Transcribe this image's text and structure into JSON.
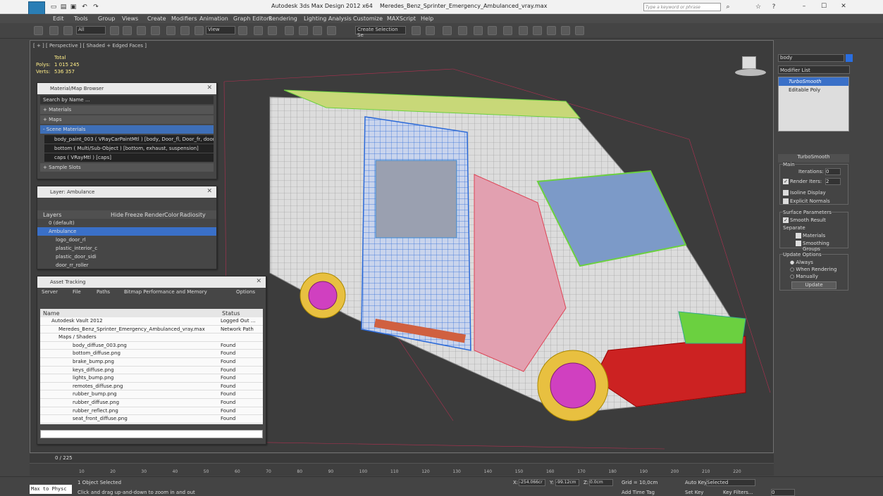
{
  "title": {
    "app": "Autodesk 3ds Max Design 2012 x64",
    "file": "Meredes_Benz_Sprinter_Emergency_Ambulanced_vray.max",
    "search_placeholder": "Type a keyword or phrase"
  },
  "menu": [
    "Edit",
    "Tools",
    "Group",
    "Views",
    "Create",
    "Modifiers",
    "Animation",
    "Graph Editors",
    "Rendering",
    "Lighting Analysis",
    "Customize",
    "MAXScript",
    "Help"
  ],
  "toolbar": {
    "filter": "All",
    "refcoord": "View",
    "selset": "Create Selection Se"
  },
  "viewport": {
    "label": "[ + ] [ Perspective ] [ Shaded + Edged Faces ]",
    "stats_total": "Total",
    "polys_label": "Polys:",
    "polys": "1 015 245",
    "verts_label": "Verts:",
    "verts": "536 357"
  },
  "material_browser": {
    "title": "Material/Map Browser",
    "search": "Search by Name ...",
    "groups": [
      "+ Materials",
      "+ Maps",
      "- Scene Materials"
    ],
    "items": [
      "body_paint_003 ( VRayCarPaintMtl ) [body, Door_fl, Door_fr, door_...",
      "bottom ( Multi/Sub-Object ) [bottom, exhaust, suspension]",
      "caps ( VRayMtl ) [caps]"
    ],
    "sample": "+ Sample Slots"
  },
  "layer": {
    "title": "Layer: Ambulance",
    "cols": [
      "Layers",
      "Hide",
      "Freeze",
      "Render",
      "Color",
      "Radiosity"
    ],
    "rows": [
      "0 (default)",
      "Ambulance",
      "logo_door_rl",
      "plastic_interior_c",
      "plastic_door_sidi",
      "door_rr_roller"
    ]
  },
  "asset": {
    "title": "Asset Tracking",
    "menu": [
      "Server",
      "File",
      "Paths",
      "Bitmap Performance and Memory",
      "Options"
    ],
    "cols": [
      "Name",
      "Status"
    ],
    "rows": [
      {
        "name": "Autodesk Vault 2012",
        "status": "Logged Out ..."
      },
      {
        "name": "Meredes_Benz_Sprinter_Emergency_Ambulanced_vray.max",
        "status": "Network Path"
      },
      {
        "name": "Maps / Shaders",
        "status": ""
      },
      {
        "name": "body_diffuse_003.png",
        "status": "Found"
      },
      {
        "name": "bottom_diffuse.png",
        "status": "Found"
      },
      {
        "name": "brake_bump.png",
        "status": "Found"
      },
      {
        "name": "keys_diffuse.png",
        "status": "Found"
      },
      {
        "name": "lights_bump.png",
        "status": "Found"
      },
      {
        "name": "remotes_diffuse.png",
        "status": "Found"
      },
      {
        "name": "rubber_bump.png",
        "status": "Found"
      },
      {
        "name": "rubber_diffuse.png",
        "status": "Found"
      },
      {
        "name": "rubber_reflect.png",
        "status": "Found"
      },
      {
        "name": "seat_front_diffuse.png",
        "status": "Found"
      }
    ]
  },
  "cmd": {
    "name": "body",
    "modlist": "Modifier List",
    "stack": [
      "TurboSmooth",
      "Editable Poly"
    ],
    "rollout": "TurboSmooth",
    "main": "Main",
    "iterations_label": "Iterations:",
    "iterations": "0",
    "render_iters_label": "Render Iters:",
    "render_iters": "2",
    "isoline": "Isoline Display",
    "explicit": "Explicit Normals",
    "surface": "Surface Parameters",
    "smooth": "Smooth Result",
    "separate": "Separate",
    "materials": "Materials",
    "smoothing": "Smoothing Groups",
    "update_opts": "Update Options",
    "always": "Always",
    "when_rendering": "When Rendering",
    "manually": "Manually",
    "update_btn": "Update"
  },
  "timeline": {
    "frame": "0 / 225",
    "ticks": [
      "10",
      "20",
      "30",
      "40",
      "50",
      "60",
      "70",
      "80",
      "90",
      "100",
      "110",
      "120",
      "130",
      "140",
      "150",
      "160",
      "170",
      "180",
      "190",
      "200",
      "210",
      "220"
    ]
  },
  "status": {
    "maxscript": "Max to Physc",
    "selected": "1 Object Selected",
    "prompt": "Click and drag up-and-down to zoom in and out",
    "x_label": "X:",
    "x": "-254.066cr",
    "y_label": "Y:",
    "y": "-99.12cm",
    "z_label": "Z:",
    "z": "0.0cm",
    "grid": "Grid = 10,0cm",
    "addtime": "Add Time Tag",
    "autokey": "Auto Key",
    "setkey": "Set Key",
    "selected_dd": "Selected",
    "keyfilters": "Key Filters...",
    "frame": "0"
  }
}
